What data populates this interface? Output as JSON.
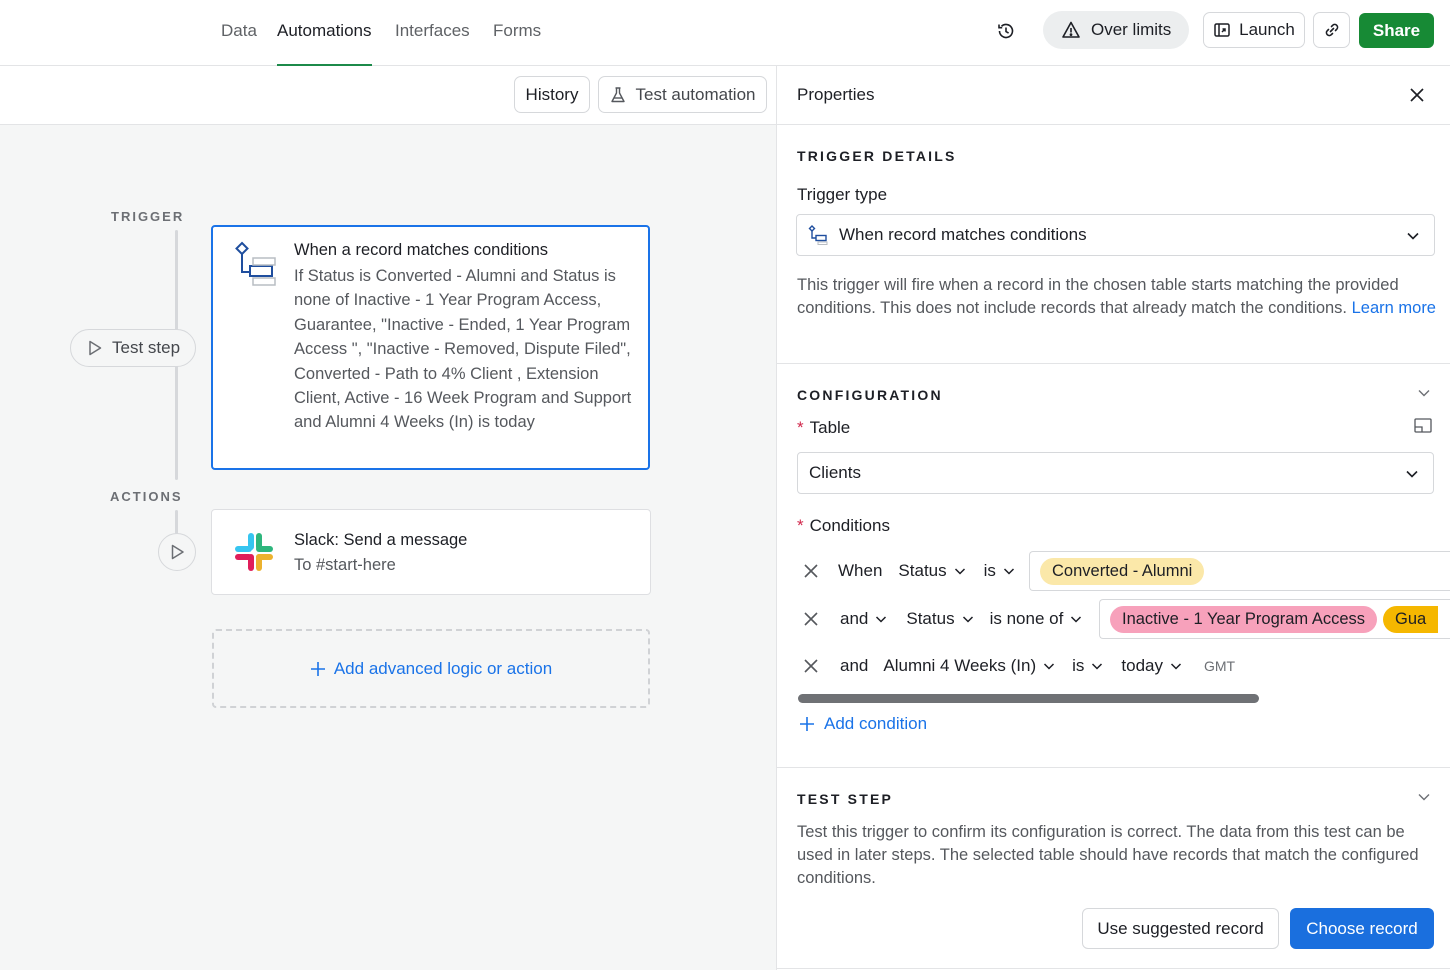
{
  "nav": {
    "tabs": [
      "Data",
      "Automations",
      "Interfaces",
      "Forms"
    ],
    "over_limits": "Over limits",
    "launch": "Launch",
    "share": "Share"
  },
  "canvas": {
    "history": "History",
    "test_automation": "Test automation",
    "trigger_label": "TRIGGER",
    "actions_label": "ACTIONS",
    "test_step": "Test step",
    "trigger_card": {
      "title": "When a record matches conditions",
      "description": "If Status is Converted - Alumni and Status is none of Inactive - 1 Year Program Access, Guarantee, \"Inactive - Ended, 1 Year Program Access \", \"Inactive - Removed, Dispute Filed\", Converted - Path to 4% Client , Extension Client, Active - 16 Week Program and Support and Alumni 4 Weeks (In) is today"
    },
    "action_card": {
      "title": "Slack: Send a message",
      "description": "To #start-here"
    },
    "add_logic": "Add advanced logic or action"
  },
  "panel": {
    "title": "Properties",
    "trigger_details": {
      "heading": "TRIGGER DETAILS",
      "trigger_type_label": "Trigger type",
      "trigger_type_value": "When record matches conditions",
      "description": "This trigger will fire when a record in the chosen table starts matching the provided conditions. This does not include records that already match the conditions.",
      "learn_more": "Learn more"
    },
    "configuration": {
      "heading": "CONFIGURATION",
      "table_label": "Table",
      "table_value": "Clients",
      "conditions_label": "Conditions",
      "rows": [
        {
          "conj": "When",
          "field": "Status",
          "op": "is",
          "values": [
            "Converted - Alumni"
          ]
        },
        {
          "conj": "and",
          "field": "Status",
          "op": "is none of",
          "values": [
            "Inactive - 1 Year Program Access",
            "Gua"
          ]
        },
        {
          "conj": "and",
          "field": "Alumni 4 Weeks (In)",
          "op": "is",
          "mode": "today",
          "tz": "GMT"
        }
      ],
      "add_condition": "Add condition"
    },
    "test_step": {
      "heading": "TEST STEP",
      "description": "Test this trigger to confirm its configuration is correct. The data from this test can be used in later steps. The selected table should have records that match the configured conditions.",
      "use_suggested": "Use suggested record",
      "choose_record": "Choose record"
    }
  },
  "colors": {
    "accent": "#1a73e8",
    "share": "#178a35",
    "chip_yellow": "#fbe8a9",
    "chip_pink": "#f7a1bb",
    "chip_orange": "#f5b700"
  }
}
